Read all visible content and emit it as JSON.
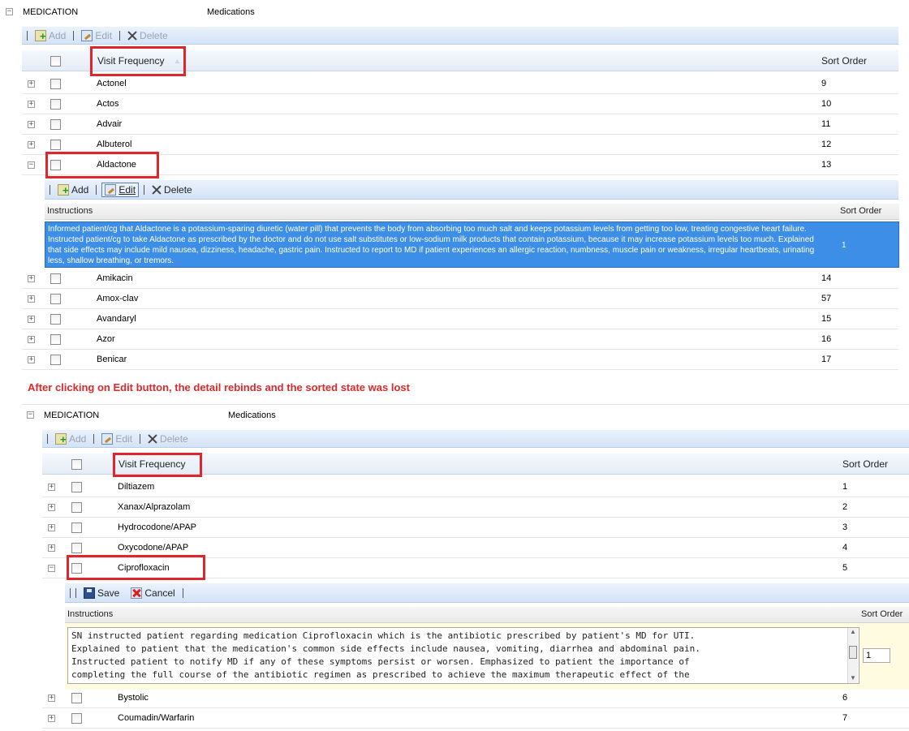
{
  "top": {
    "group_label": "MEDICATION",
    "group_value": "Medications",
    "toolbar": {
      "add": "Add",
      "edit": "Edit",
      "delete": "Delete"
    },
    "columns": {
      "name": "Visit Frequency",
      "sort": "Sort Order"
    },
    "rows_before": [
      {
        "name": "Actonel",
        "sort": "9"
      },
      {
        "name": "Actos",
        "sort": "10"
      },
      {
        "name": "Advair",
        "sort": "11"
      },
      {
        "name": "Albuterol",
        "sort": "12"
      },
      {
        "name": "Aldactone",
        "sort": "13"
      }
    ],
    "detail": {
      "toolbar": {
        "add": "Add",
        "edit": "Edit",
        "delete": "Delete"
      },
      "columns": {
        "instructions": "Instructions",
        "sort": "Sort Order"
      },
      "instructions": "Informed patient/cg that Aldactone is a potassium-sparing diuretic (water pill) that prevents the body from absorbing too much salt and keeps potassium levels from getting too low, treating congestive heart failure. Instructed patient/cg to take Aldactone as prescribed by the doctor and do not use salt substitutes or low-sodium milk products that contain potassium, because it may increase potassium levels too much. Explained that side effects may include mild nausea, dizziness, headache, gastric pain. Instructed to report to MD if patient experiences an allergic reaction, numbness, muscle pain or weakness, irregular heartbeats, urinating less, shallow breathing, or tremors.",
      "sort": "1"
    },
    "rows_after": [
      {
        "name": "Amikacin",
        "sort": "14"
      },
      {
        "name": "Amox-clav",
        "sort": "57"
      },
      {
        "name": "Avandaryl",
        "sort": "15"
      },
      {
        "name": "Azor",
        "sort": "16"
      },
      {
        "name": "Benicar",
        "sort": "17"
      }
    ]
  },
  "caption": "After clicking on Edit button, the detail rebinds and the sorted state was lost",
  "bottom": {
    "group_label": "MEDICATION",
    "group_value": "Medications",
    "toolbar": {
      "add": "Add",
      "edit": "Edit",
      "delete": "Delete"
    },
    "columns": {
      "name": "Visit Frequency",
      "sort": "Sort Order"
    },
    "rows_before": [
      {
        "name": "Diltiazem",
        "sort": "1"
      },
      {
        "name": "Xanax/Alprazolam",
        "sort": "2"
      },
      {
        "name": "Hydrocodone/APAP",
        "sort": "3"
      },
      {
        "name": "Oxycodone/APAP",
        "sort": "4"
      },
      {
        "name": "Ciprofloxacin",
        "sort": "5"
      }
    ],
    "detail": {
      "toolbar": {
        "save": "Save",
        "cancel": "Cancel"
      },
      "columns": {
        "instructions": "Instructions",
        "sort": "Sort Order"
      },
      "instructions": "SN instructed patient regarding medication Ciprofloxacin which is the antibiotic prescribed by patient's MD for UTI.\nExplained to patient that the medication's common side effects include nausea, vomiting, diarrhea and abdominal pain.\nInstructed patient to notify MD if any of these symptoms persist or worsen. Emphasized to patient the importance of\ncompleting the full course of the antibiotic regimen as prescribed to achieve the maximum therapeutic effect of the",
      "sort": "1"
    },
    "rows_after": [
      {
        "name": "Bystolic",
        "sort": "6"
      },
      {
        "name": "Coumadin/Warfarin",
        "sort": "7"
      }
    ]
  }
}
